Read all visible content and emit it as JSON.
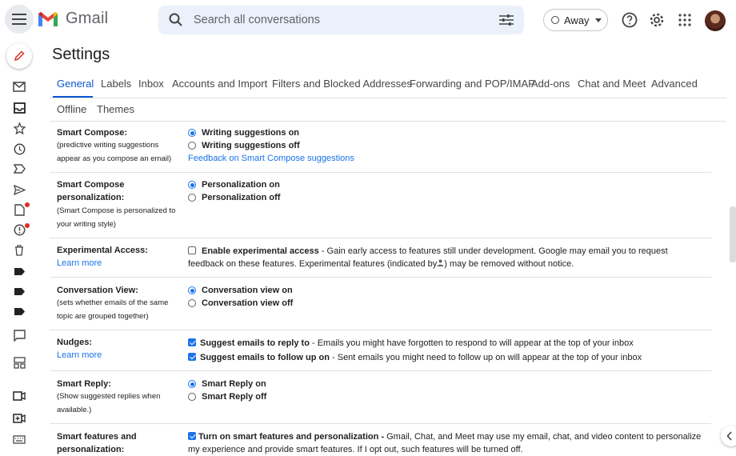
{
  "app": {
    "name": "Gmail"
  },
  "search": {
    "placeholder": "Search all conversations"
  },
  "status": {
    "label": "Away"
  },
  "page": {
    "title": "Settings"
  },
  "tabs": [
    {
      "label": "General"
    },
    {
      "label": "Labels"
    },
    {
      "label": "Inbox"
    },
    {
      "label": "Accounts and Import"
    },
    {
      "label": "Filters and Blocked Addresses"
    },
    {
      "label": "Forwarding and POP/IMAP"
    },
    {
      "label": "Add-ons"
    },
    {
      "label": "Chat and Meet"
    },
    {
      "label": "Advanced"
    },
    {
      "label": "Offline"
    },
    {
      "label": "Themes"
    }
  ],
  "settings": {
    "smart_compose": {
      "label": "Smart Compose:",
      "desc1": "(predictive writing suggestions",
      "desc2": "appear as you compose an email)",
      "opt_on": "Writing suggestions on",
      "opt_off": "Writing suggestions off",
      "feedback": "Feedback on Smart Compose suggestions",
      "selected": "on"
    },
    "personalization": {
      "label1": "Smart Compose",
      "label2": "personalization:",
      "desc1": "(Smart Compose is personalized to",
      "desc2": "your writing style)",
      "opt_on": "Personalization on",
      "opt_off": "Personalization off",
      "selected": "on"
    },
    "experimental": {
      "label": "Experimental Access:",
      "learn": "Learn more",
      "title": "Enable experimental access",
      "text1": " - Gain early access to features still under development. Google may email you to request",
      "text2a": "feedback on these features. Experimental features (indicated by",
      "text2b": ") may be removed without notice.",
      "checked": false
    },
    "conversation": {
      "label": "Conversation View:",
      "desc1": "(sets whether emails of the same",
      "desc2": "topic are grouped together)",
      "opt_on": "Conversation view on",
      "opt_off": "Conversation view off",
      "selected": "on"
    },
    "nudges": {
      "label": "Nudges:",
      "learn": "Learn more",
      "reply_title": "Suggest emails to reply to",
      "reply_text": " - Emails you might have forgotten to respond to will appear at the top of your inbox",
      "follow_title": "Suggest emails to follow up on",
      "follow_text": " - Sent emails you might need to follow up on will appear at the top of your inbox",
      "reply_checked": true,
      "follow_checked": true
    },
    "smart_reply": {
      "label": "Smart Reply:",
      "desc1": "(Show suggested replies when",
      "desc2": "available.)",
      "opt_on": "Smart Reply on",
      "opt_off": "Smart Reply off",
      "selected": "on"
    },
    "smart_features": {
      "label1": "Smart features and",
      "label2": "personalization:",
      "title": "Turn on smart features and personalization -",
      "text1": " Gmail, Chat, and Meet may use my email, chat, and video content to personalize",
      "text2": "my experience and provide smart features. If I opt out, such features will be turned off.",
      "checked": true
    }
  },
  "colors": {
    "accent": "#0b57d0",
    "link": "#1a73e8",
    "notification": "#d93025"
  },
  "icons": {
    "rail": [
      "pencil-icon",
      "mail-icon",
      "inbox-icon",
      "star-icon",
      "clock-icon",
      "label-arrow-icon",
      "send-icon",
      "draft-icon",
      "report-icon",
      "trash-icon",
      "label-icon",
      "label-icon",
      "label-icon",
      "chat-icon",
      "spaces-icon",
      "video-icon",
      "new-meeting-icon",
      "keyboard-icon"
    ]
  }
}
